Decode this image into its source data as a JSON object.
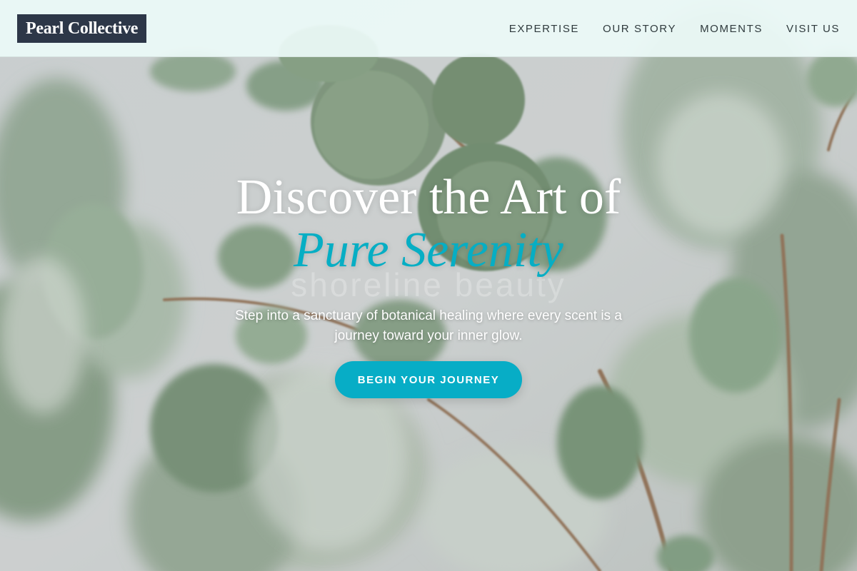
{
  "brand": {
    "name": "Pearl Collective"
  },
  "nav": {
    "items": [
      "EXPERTISE",
      "OUR STORY",
      "MOMENTS",
      "VISIT US"
    ]
  },
  "hero": {
    "title_line1": "Discover the Art of",
    "title_accent": "Pure Serenity",
    "watermark": "shoreline beauty",
    "subtitle": "Step into a sanctuary of botanical healing where every scent is a journey toward your inner glow.",
    "cta": "BEGIN YOUR JOURNEY",
    "image": "eucalyptus-branches"
  },
  "colors": {
    "accent": "#06aec4",
    "logo_bg": "#2d3748",
    "nav_bg": "#ecfaf8",
    "nav_text": "#2f3a3d"
  }
}
